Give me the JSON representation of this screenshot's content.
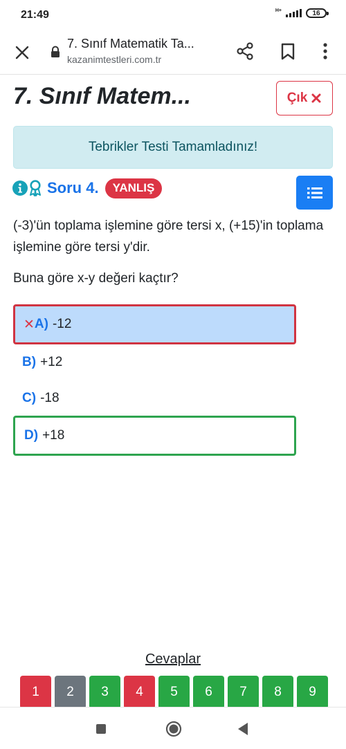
{
  "status": {
    "time": "21:49",
    "network": "H+",
    "battery": "16"
  },
  "browser": {
    "tab_title": "7. Sınıf Matematik Ta...",
    "url": "kazanimtestleri.com.tr",
    "icons": [
      "close-icon",
      "lock-icon",
      "share-icon",
      "bookmark-icon",
      "more-icon"
    ]
  },
  "page": {
    "title": "7. Sınıf Matem...",
    "exit_label": "Çık",
    "success_alert": "Tebrikler Testi Tamamladınız!"
  },
  "question": {
    "number_label": "Soru 4.",
    "result_badge": "YANLIŞ",
    "text": "(-3)'ün toplama işlemine göre tersi x, (+15)'in toplama işlemine göre tersi y'dir.",
    "prompt": "Buna göre x-y değeri kaçtır?",
    "options": [
      {
        "letter": "A)",
        "value": "-12",
        "state": "selected-wrong"
      },
      {
        "letter": "B)",
        "value": "+12",
        "state": "none"
      },
      {
        "letter": "C)",
        "value": "-18",
        "state": "none"
      },
      {
        "letter": "D)",
        "value": "+18",
        "state": "correct"
      }
    ]
  },
  "answers": {
    "title": "Cevaplar",
    "items": [
      {
        "label": "1",
        "status": "wrong",
        "color": "#dc3545"
      },
      {
        "label": "2",
        "status": "empty",
        "color": "#6c757d"
      },
      {
        "label": "3",
        "status": "correct",
        "color": "#28a745"
      },
      {
        "label": "4",
        "status": "wrong",
        "color": "#dc3545"
      },
      {
        "label": "5",
        "status": "correct",
        "color": "#28a745"
      },
      {
        "label": "6",
        "status": "correct",
        "color": "#28a745"
      },
      {
        "label": "7",
        "status": "correct",
        "color": "#28a745"
      },
      {
        "label": "8",
        "status": "correct",
        "color": "#28a745"
      },
      {
        "label": "9",
        "status": "correct",
        "color": "#28a745"
      }
    ]
  },
  "colors": {
    "accent": "#1a73e8",
    "wrong": "#dc3545",
    "correct": "#28a745",
    "alert_bg": "#d1ecf1",
    "alert_text": "#0c5460"
  }
}
